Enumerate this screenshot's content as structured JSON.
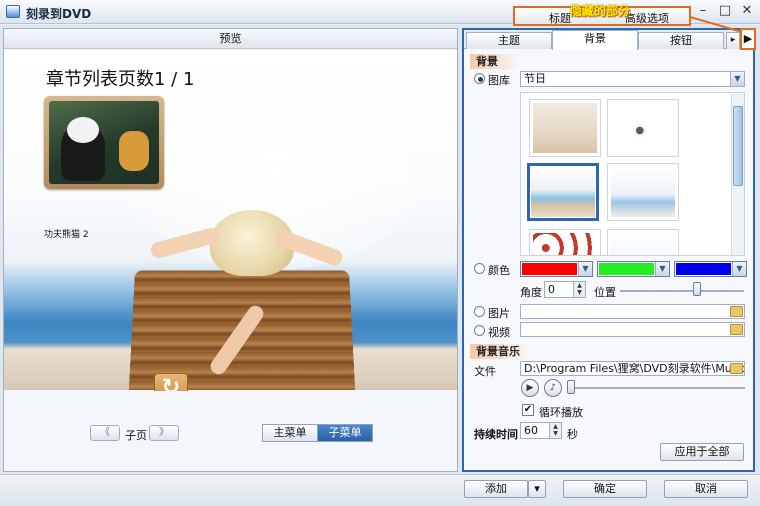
{
  "window": {
    "title": "刻录到DVD",
    "minimize": "–",
    "maximize": "□",
    "close": "✕"
  },
  "annotation": {
    "label": "隐藏的部分",
    "top_tab_title": "标题",
    "top_tab_advanced": "高级选项",
    "more_arrow": "▶"
  },
  "preview": {
    "header": "预览",
    "page_title": "章节列表页数1 / 1",
    "thumbnail_caption": "功夫熊猫 2",
    "return_icon": "↻",
    "prev_arrow": "《",
    "next_arrow": "》",
    "subpage_label": "子页",
    "main_menu": "主菜单",
    "sub_menu": "子菜单"
  },
  "panel": {
    "tabs": [
      "主题",
      "背景",
      "按钮"
    ],
    "active_tab": "背景",
    "tab_scroll_arrow": "▸",
    "background": {
      "section": "背景",
      "library_label": "图库",
      "library_value": "节日",
      "selected_option": "图库",
      "color_label": "颜色",
      "colors": [
        "#ff0000",
        "#22ee22",
        "#0000ee"
      ],
      "angle_label": "角度",
      "angle_value": "0",
      "position_label": "位置",
      "position_level": 0.62,
      "picture_label": "图片",
      "picture_value": "",
      "video_label": "视频",
      "video_value": ""
    },
    "music": {
      "section": "背景音乐",
      "file_label": "文件",
      "file_path": "D:\\Program Files\\狸窝\\DVD刻录软件\\Music\\defa",
      "play_icon": "▶",
      "note_icon": "♪",
      "loop_label": "循环播放",
      "loop_checked": "✔"
    },
    "duration_label": "持续时间",
    "duration_value": "60",
    "duration_unit": "秒",
    "apply_all": "应用于全部"
  },
  "footer": {
    "add": "添加",
    "add_dropdown": "▾",
    "ok": "确定",
    "cancel": "取消"
  },
  "icons": {
    "app": "dvd-burner-icon",
    "folder": "folder-icon",
    "dropdown": "chevron-down-icon"
  },
  "accent_color": "#2c66b2"
}
